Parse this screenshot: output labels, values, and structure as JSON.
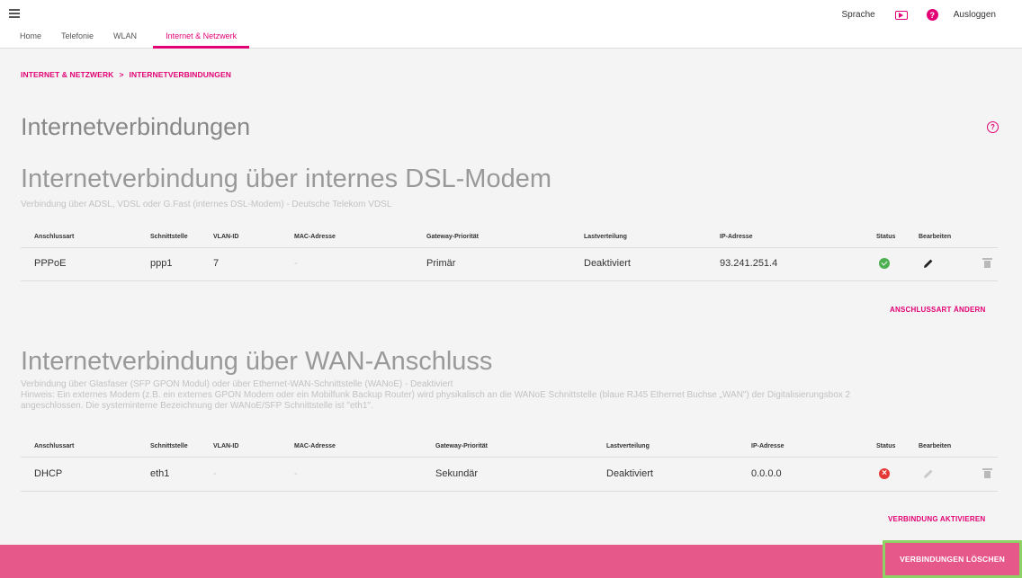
{
  "nav": {
    "tabs": [
      {
        "label": "Home"
      },
      {
        "label": "Telefonie"
      },
      {
        "label": "WLAN"
      },
      {
        "label": "Internet & Netzwerk"
      }
    ],
    "active_tab": "Internet & Netzwerk",
    "language": "Sprache",
    "help_glyph": "?",
    "logout": "Ausloggen"
  },
  "breadcrumb": {
    "parent": "INTERNET & NETZWERK",
    "separator": ">",
    "current": "INTERNETVERBINDUNGEN"
  },
  "page": {
    "title": "Internetverbindungen",
    "help_glyph": "?"
  },
  "dsl": {
    "title": "Internetverbindung über internes DSL-Modem",
    "description": "Verbindung über ADSL, VDSL oder G.Fast (internes DSL-Modem) - Deutsche Telekom VDSL",
    "columns": [
      "Anschlussart",
      "Schnittstelle",
      "VLAN-ID",
      "MAC-Adresse",
      "Gateway-Priorität",
      "Lastverteilung",
      "IP-Adresse",
      "Status",
      "Bearbeiten"
    ],
    "row": {
      "type": "PPPoE",
      "interface": "ppp1",
      "vlan": "7",
      "mac": "-",
      "priority": "Primär",
      "load_balancing": "Deaktiviert",
      "ip": "93.241.251.4",
      "status": "ok"
    },
    "action": "ANSCHLUSSART ÄNDERN"
  },
  "wan": {
    "title": "Internetverbindung über WAN-Anschluss",
    "description_line1": "Verbindung über Glasfaser (SFP GPON Modul) oder über Ethernet-WAN-Schnittstelle (WANoE)  -  Deaktiviert",
    "description_line2": "Hinweis: Ein externes Modem (z.B. ein externes GPON Modem oder ein Mobilfunk Backup Router) wird physikalisch an die WANoE Schnittstelle (blaue RJ45 Ethernet Buchse „WAN\") der Digitalisierungsbox 2",
    "description_line3": "angeschlossen. Die systeminterne Bezeichnung der WANoE/SFP Schnittstelle ist \"eth1\".",
    "columns": [
      "Anschlussart",
      "Schnittstelle",
      "VLAN-ID",
      "MAC-Adresse",
      "Gateway-Priorität",
      "Lastverteilung",
      "IP-Adresse",
      "Status",
      "Bearbeiten"
    ],
    "row": {
      "type": "DHCP",
      "interface": "eth1",
      "vlan": "-",
      "mac": "-",
      "priority": "Sekundär",
      "load_balancing": "Deaktiviert",
      "ip": "0.0.0.0",
      "status": "error",
      "status_glyph": "×"
    },
    "action": "VERBINDUNG AKTIVIEREN"
  },
  "footer": {
    "delete_label": "VERBINDUNGEN LÖSCHEN"
  },
  "colors": {
    "brand": "#e20074",
    "footer": "#e6578a",
    "highlight_border": "#8ed165",
    "status_ok": "#4caf50",
    "status_error": "#e53935"
  },
  "icons": [
    "menu-icon",
    "play-icon",
    "help-icon",
    "help-outline-icon",
    "check-circle-icon",
    "error-circle-icon",
    "pencil-icon",
    "trash-icon"
  ]
}
